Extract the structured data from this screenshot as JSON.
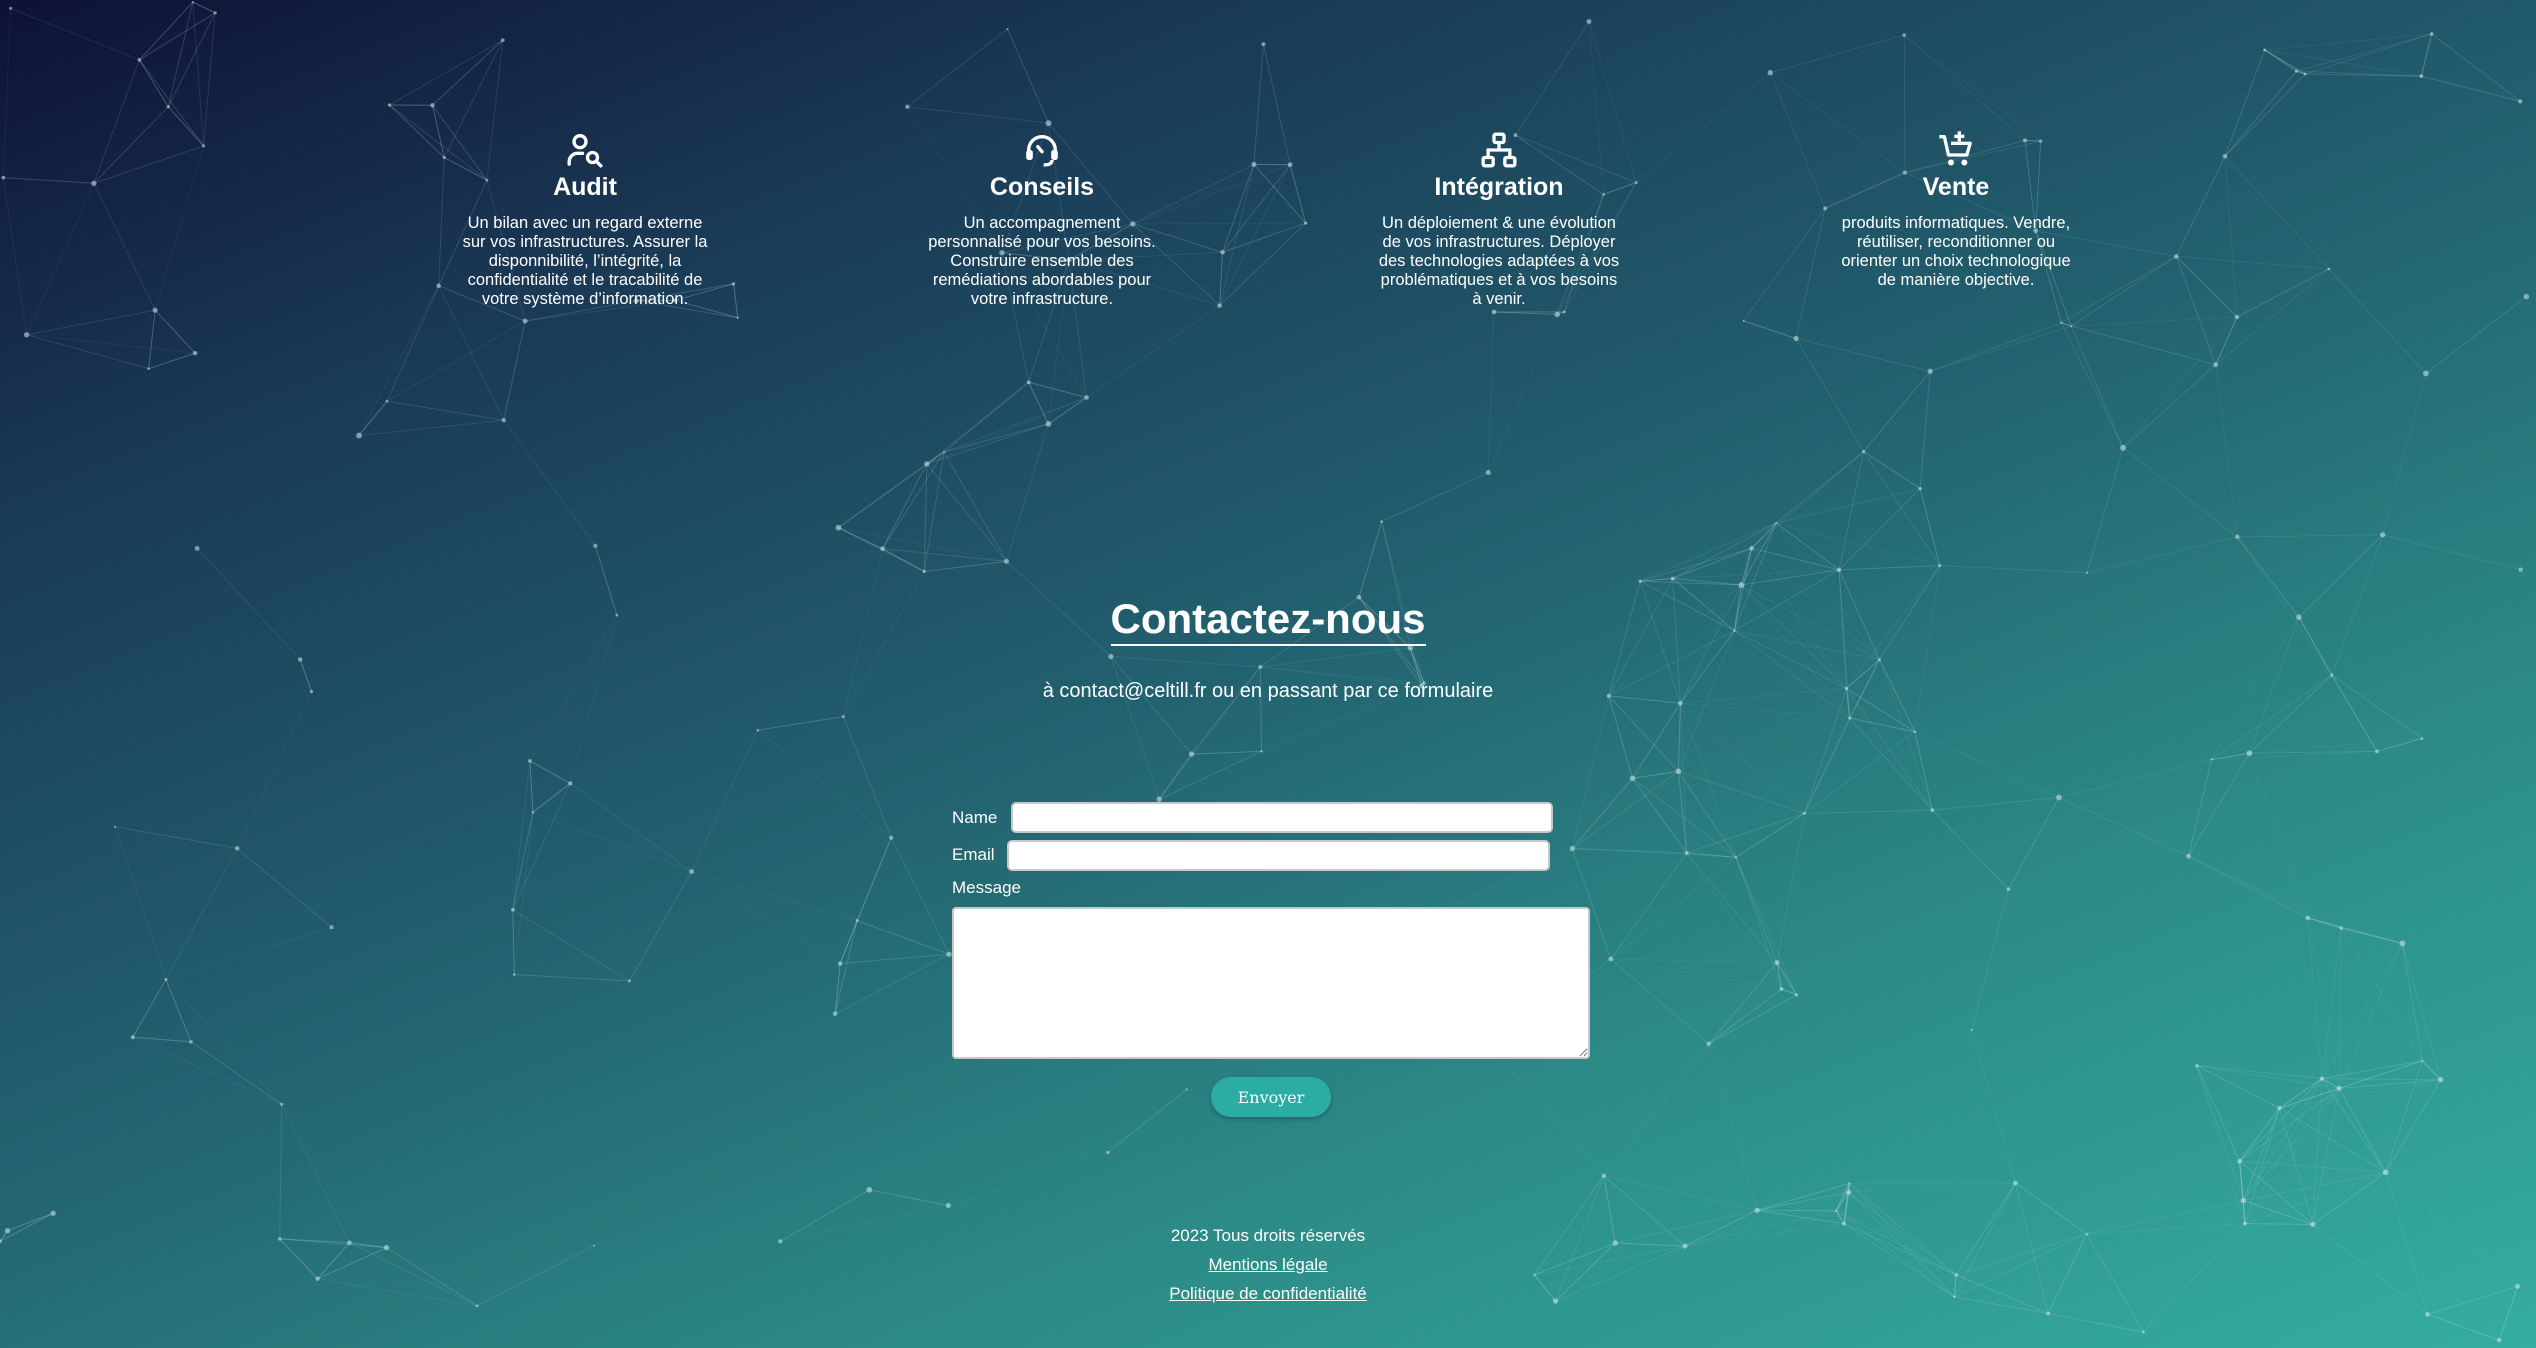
{
  "services": [
    {
      "icon": "user-search-icon",
      "title": "Audit",
      "description": "Un bilan avec un regard externe sur vos infrastructures. Assurer la disponnibilité, l’intégrité, la confidentialité et le tracabilité de votre système d’information."
    },
    {
      "icon": "headset-icon",
      "title": "Conseils",
      "description": "Un accompagnement personnalisé pour vos besoins. Construire ensemble des remédiations abordables pour votre infrastructure."
    },
    {
      "icon": "hierarchy-icon",
      "title": "Intégration",
      "description": "Un déploiement & une évolution de vos infrastructures. Déployer des technologies adaptées à vos problématiques et à vos besoins à venir."
    },
    {
      "icon": "cart-plus-icon",
      "title": "Vente",
      "description": "produits informatiques. Vendre, réutiliser, reconditionner ou orienter un choix technologique de manière objective."
    }
  ],
  "contact": {
    "title": "Contactez-nous",
    "subtitle": "à contact@celtill.fr ou en passant par ce formulaire",
    "name_label": "Name",
    "name_value": "",
    "email_label": "Email",
    "email_value": "",
    "message_label": "Message",
    "message_value": "",
    "submit_label": "Envoyer"
  },
  "footer": {
    "copyright": "2023 Tous droits réservés",
    "legal_link": "Mentions légale",
    "privacy_link": "Politique de confidentialité"
  },
  "colors": {
    "gradient_start": "#0e1235",
    "gradient_end": "#35ada0",
    "button": "#2cada3",
    "network_lines": "#cfe8ea"
  }
}
